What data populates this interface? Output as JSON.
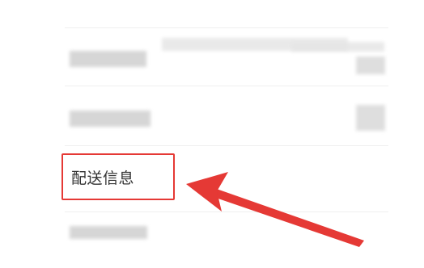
{
  "menu": {
    "delivery_info_label": "配送信息"
  },
  "annotation": {
    "highlight_color": "#e53935",
    "arrow_color": "#e53935"
  }
}
